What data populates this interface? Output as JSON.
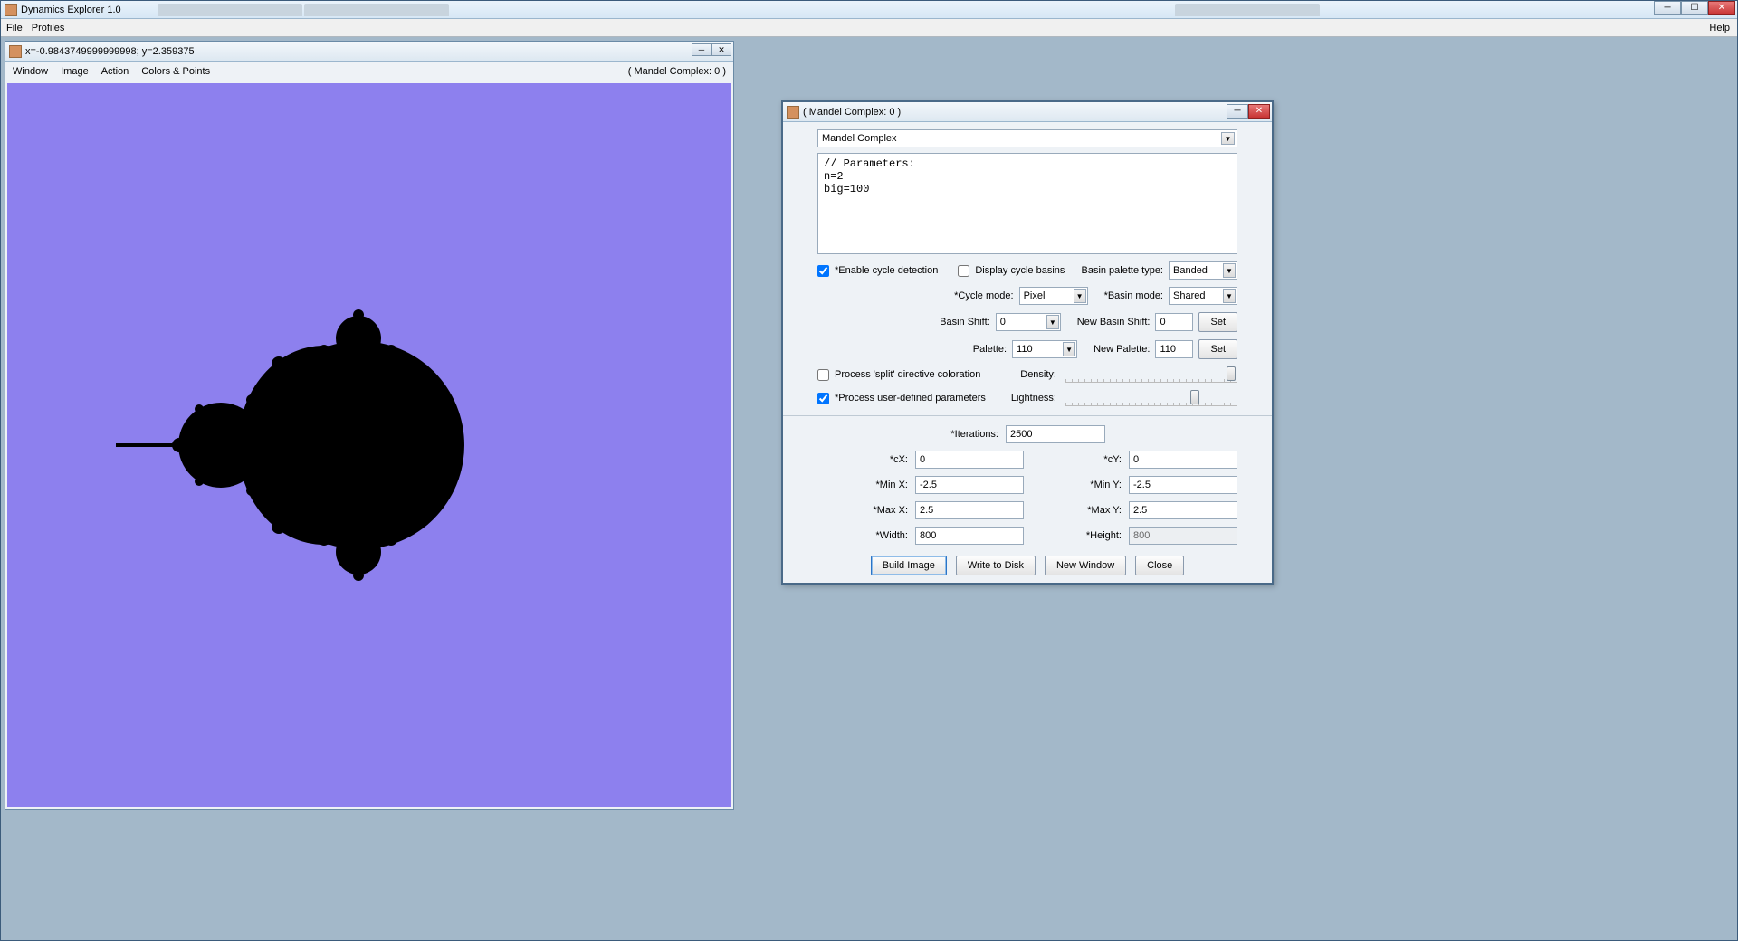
{
  "app": {
    "title": "Dynamics Explorer 1.0"
  },
  "menubar": {
    "file": "File",
    "profiles": "Profiles",
    "help": "Help"
  },
  "image_window": {
    "title": "x=-0.9843749999999998; y=2.359375",
    "menu": {
      "window": "Window",
      "image": "Image",
      "action": "Action",
      "colors": "Colors & Points"
    },
    "doc_label": "( Mandel Complex: 0 )"
  },
  "dialog": {
    "title": "( Mandel Complex: 0 )",
    "type_select": "Mandel Complex",
    "parameters_text": "// Parameters:\nn=2\nbig=100",
    "enable_cycle_label": "*Enable cycle detection",
    "enable_cycle_checked": true,
    "display_basins_label": "Display cycle basins",
    "display_basins_checked": false,
    "basin_palette_type_label": "Basin palette type:",
    "basin_palette_type": "Banded",
    "cycle_mode_label": "*Cycle mode:",
    "cycle_mode": "Pixel",
    "basin_mode_label": "*Basin mode:",
    "basin_mode": "Shared",
    "basin_shift_label": "Basin Shift:",
    "basin_shift": "0",
    "new_basin_shift_label": "New Basin Shift:",
    "new_basin_shift": "0",
    "set1": "Set",
    "palette_label": "Palette:",
    "palette": "110",
    "new_palette_label": "New Palette:",
    "new_palette": "110",
    "set2": "Set",
    "split_label": "Process 'split' directive coloration",
    "split_checked": false,
    "density_label": "Density:",
    "userparams_label": "*Process user-defined parameters",
    "userparams_checked": true,
    "lightness_label": "Lightness:",
    "iterations_label": "*Iterations:",
    "iterations": "2500",
    "cx_label": "*cX:",
    "cx": "0",
    "cy_label": "*cY:",
    "cy": "0",
    "minx_label": "*Min X:",
    "minx": "-2.5",
    "miny_label": "*Min Y:",
    "miny": "-2.5",
    "maxx_label": "*Max X:",
    "maxx": "2.5",
    "maxy_label": "*Max Y:",
    "maxy": "2.5",
    "width_label": "*Width:",
    "width": "800",
    "height_label": "*Height:",
    "height": "800",
    "build": "Build Image",
    "write": "Write to Disk",
    "newwin": "New Window",
    "close": "Close"
  }
}
